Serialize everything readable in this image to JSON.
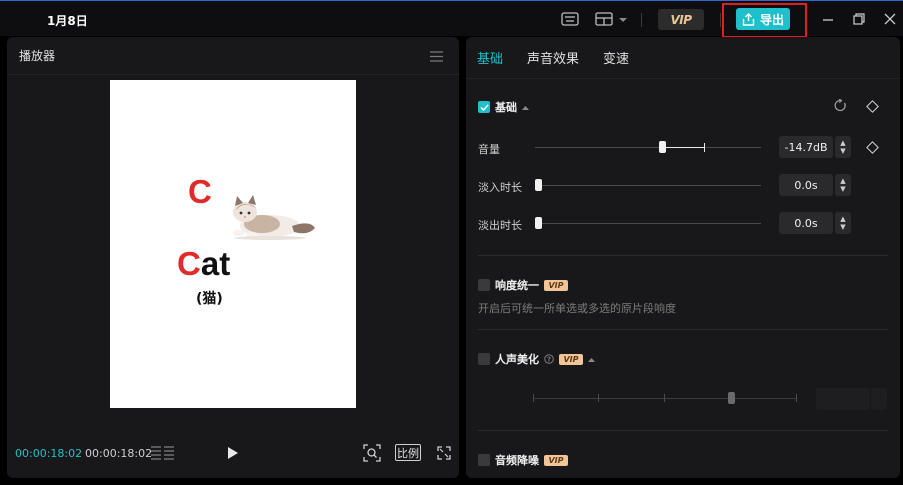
{
  "titlebar": {
    "project_title": "1月8日",
    "vip_label": "VIP",
    "export_label": "导出"
  },
  "player": {
    "title": "播放器",
    "current_time": "00:00:18:02",
    "total_time": "00:00:18:02",
    "ratio_label": "比例",
    "canvas": {
      "letter": "C",
      "word_first": "C",
      "word_rest": "at",
      "word_cn": "(猫)"
    }
  },
  "props": {
    "tabs": [
      "基础",
      "声音效果",
      "变速"
    ],
    "active_tab": "基础",
    "basic": {
      "title": "基础",
      "checked": true,
      "volume_label": "音量",
      "volume_value": "-14.7dB",
      "fade_in_label": "淡入时长",
      "fade_in_value": "0.0s",
      "fade_out_label": "淡出时长",
      "fade_out_value": "0.0s"
    },
    "loudness": {
      "title": "响度统一",
      "checked": false,
      "vip": "VIP",
      "description": "开启后可统一所单选或多选的原片段响度"
    },
    "voice": {
      "title": "人声美化",
      "checked": false,
      "vip": "VIP"
    },
    "denoise": {
      "title": "音频降噪",
      "checked": false,
      "vip": "VIP"
    }
  },
  "colors": {
    "accent": "#1fc0c9",
    "highlight_border": "#e02020",
    "letter_red": "#e02b2b",
    "vip_gold": "#f2c598"
  }
}
